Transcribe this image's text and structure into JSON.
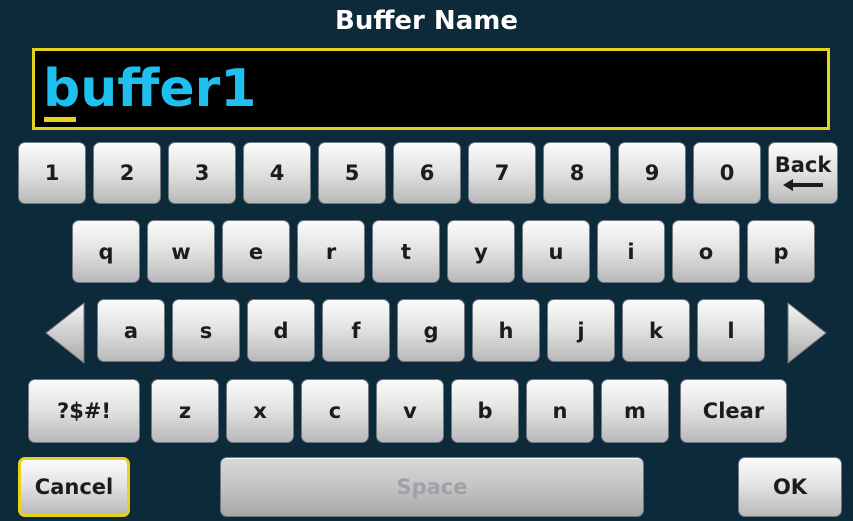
{
  "dialog": {
    "title": "Buffer Name"
  },
  "entry": {
    "value": "buffer1"
  },
  "keyboard": {
    "row1": [
      "1",
      "2",
      "3",
      "4",
      "5",
      "6",
      "7",
      "8",
      "9",
      "0"
    ],
    "back_label": "Back",
    "row2": [
      "q",
      "w",
      "e",
      "r",
      "t",
      "y",
      "u",
      "i",
      "o",
      "p"
    ],
    "row3": [
      "a",
      "s",
      "d",
      "f",
      "g",
      "h",
      "j",
      "k",
      "l"
    ],
    "symbols_label": "?$#!",
    "row4": [
      "z",
      "x",
      "c",
      "v",
      "b",
      "n",
      "m"
    ],
    "clear_label": "Clear",
    "cancel_label": "Cancel",
    "space_label": "Space",
    "ok_label": "OK"
  },
  "icons": {
    "back": "left-arrow-icon",
    "cursor_left": "triangle-left-icon",
    "cursor_right": "triangle-right-icon"
  },
  "colors": {
    "background": "#0d2a3a",
    "highlight": "#e5d21c",
    "entry_text": "#1ec0ef"
  }
}
